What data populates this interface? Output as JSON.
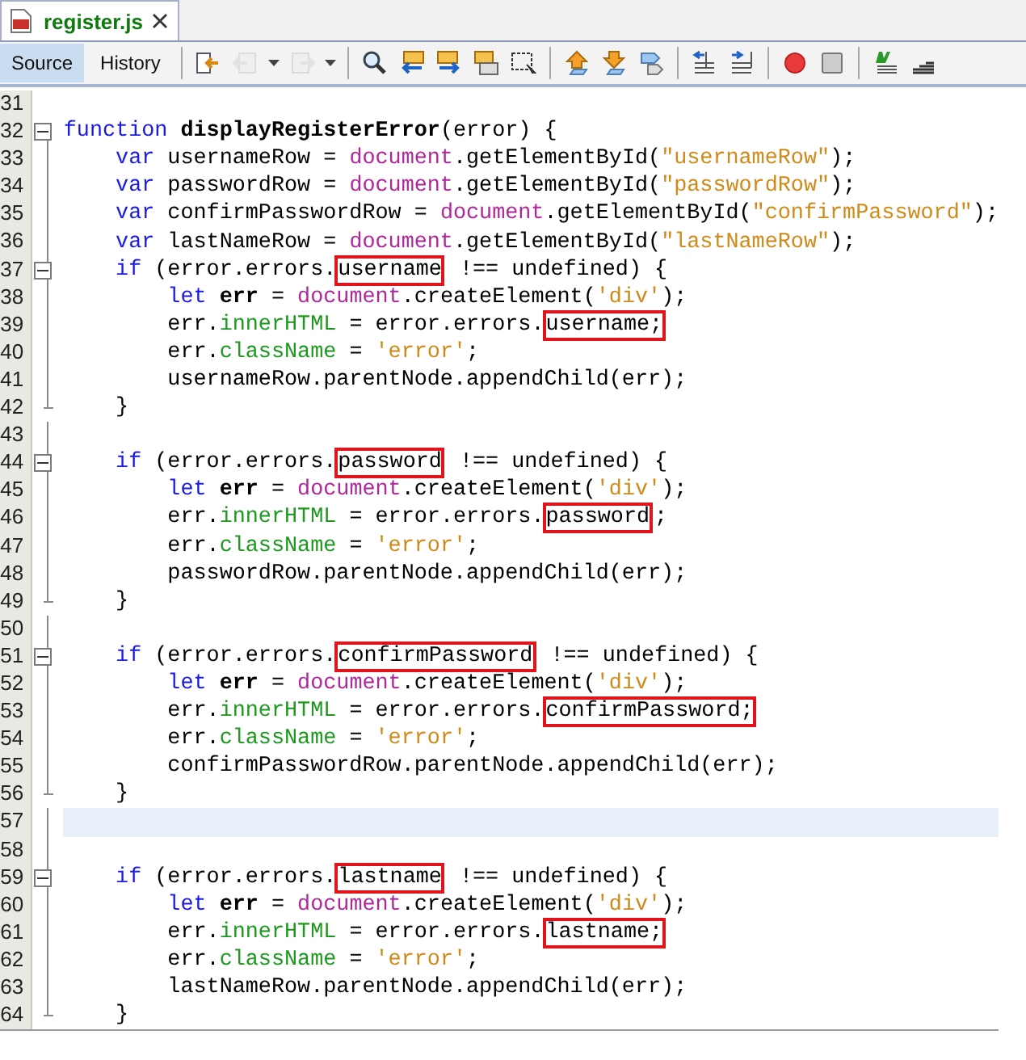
{
  "file_tab": {
    "title": "register.js",
    "selected": true
  },
  "view_tabs": [
    {
      "label": "Source",
      "selected": true
    },
    {
      "label": "History",
      "selected": false
    }
  ],
  "toolbar": [
    {
      "kind": "last-edit",
      "disabled": false
    },
    {
      "kind": "back",
      "disabled": true
    },
    {
      "kind": "dropdown"
    },
    {
      "kind": "forward",
      "disabled": true
    },
    {
      "kind": "dropdown"
    },
    {
      "kind": "separator"
    },
    {
      "kind": "find",
      "disabled": false
    },
    {
      "kind": "find-prev",
      "disabled": false
    },
    {
      "kind": "find-next",
      "disabled": false
    },
    {
      "kind": "highlight",
      "disabled": false
    },
    {
      "kind": "select",
      "disabled": false
    },
    {
      "kind": "separator"
    },
    {
      "kind": "prev-bookmark",
      "disabled": false
    },
    {
      "kind": "next-bookmark",
      "disabled": false
    },
    {
      "kind": "toggle-bookmark",
      "disabled": false
    },
    {
      "kind": "separator"
    },
    {
      "kind": "shift-left",
      "disabled": false
    },
    {
      "kind": "shift-right",
      "disabled": false
    },
    {
      "kind": "separator"
    },
    {
      "kind": "record",
      "disabled": false
    },
    {
      "kind": "stop",
      "disabled": false
    },
    {
      "kind": "separator"
    },
    {
      "kind": "comment",
      "disabled": false
    },
    {
      "kind": "uncomment",
      "disabled": false
    }
  ],
  "lines": [
    {
      "number": "31",
      "current": false,
      "fold_toggle": false,
      "fold_end": false
    },
    {
      "number": "32",
      "current": false,
      "fold_toggle": true,
      "fold_end": false,
      "tokens": [
        {
          "kind": "keyword",
          "text": "function ",
          "boxed": false
        },
        {
          "kind": "declaration",
          "text": "displayRegisterError",
          "boxed": false
        },
        {
          "kind": "plain",
          "text": "(error) {",
          "boxed": false
        }
      ]
    },
    {
      "number": "33",
      "current": false,
      "fold_toggle": false,
      "fold_end": false,
      "tokens": [
        {
          "kind": "keyword",
          "text": "    var",
          "boxed": false
        },
        {
          "kind": "plain",
          "text": " usernameRow = ",
          "boxed": false
        },
        {
          "kind": "object",
          "text": "document",
          "boxed": false
        },
        {
          "kind": "plain",
          "text": ".getElementById(",
          "boxed": false
        },
        {
          "kind": "string",
          "text": "\"usernameRow\"",
          "boxed": false
        },
        {
          "kind": "plain",
          "text": ");",
          "boxed": false
        }
      ]
    },
    {
      "number": "34",
      "current": false,
      "fold_toggle": false,
      "fold_end": false,
      "tokens": [
        {
          "kind": "keyword",
          "text": "    var",
          "boxed": false
        },
        {
          "kind": "plain",
          "text": " passwordRow = ",
          "boxed": false
        },
        {
          "kind": "object",
          "text": "document",
          "boxed": false
        },
        {
          "kind": "plain",
          "text": ".getElementById(",
          "boxed": false
        },
        {
          "kind": "string",
          "text": "\"passwordRow\"",
          "boxed": false
        },
        {
          "kind": "plain",
          "text": ");",
          "boxed": false
        }
      ]
    },
    {
      "number": "35",
      "current": false,
      "fold_toggle": false,
      "fold_end": false,
      "tokens": [
        {
          "kind": "keyword",
          "text": "    var",
          "boxed": false
        },
        {
          "kind": "plain",
          "text": " confirmPasswordRow = ",
          "boxed": false
        },
        {
          "kind": "object",
          "text": "document",
          "boxed": false
        },
        {
          "kind": "plain",
          "text": ".getElementById(",
          "boxed": false
        },
        {
          "kind": "string",
          "text": "\"confirmPassword\"",
          "boxed": false
        },
        {
          "kind": "plain",
          "text": ");",
          "boxed": false
        }
      ]
    },
    {
      "number": "36",
      "current": false,
      "fold_toggle": false,
      "fold_end": false,
      "tokens": [
        {
          "kind": "keyword",
          "text": "    var",
          "boxed": false
        },
        {
          "kind": "plain",
          "text": " lastNameRow = ",
          "boxed": false
        },
        {
          "kind": "object",
          "text": "document",
          "boxed": false
        },
        {
          "kind": "plain",
          "text": ".getElementById(",
          "boxed": false
        },
        {
          "kind": "string",
          "text": "\"lastNameRow\"",
          "boxed": false
        },
        {
          "kind": "plain",
          "text": ");",
          "boxed": false
        }
      ]
    },
    {
      "number": "37",
      "current": false,
      "fold_toggle": true,
      "fold_end": false,
      "tokens": [
        {
          "kind": "keyword",
          "text": "    if",
          "boxed": false
        },
        {
          "kind": "plain",
          "text": " (error.errors.",
          "boxed": false
        },
        {
          "kind": "plain",
          "text": "username",
          "boxed": true
        },
        {
          "kind": "plain",
          "text": " !== undefined) {",
          "boxed": false
        }
      ]
    },
    {
      "number": "38",
      "current": false,
      "fold_toggle": false,
      "fold_end": false,
      "tokens": [
        {
          "kind": "keyword",
          "text": "        let ",
          "boxed": false
        },
        {
          "kind": "declaration",
          "text": "err",
          "boxed": false
        },
        {
          "kind": "plain",
          "text": " = ",
          "boxed": false
        },
        {
          "kind": "object",
          "text": "document",
          "boxed": false
        },
        {
          "kind": "plain",
          "text": ".createElement(",
          "boxed": false
        },
        {
          "kind": "string",
          "text": "'div'",
          "boxed": false
        },
        {
          "kind": "plain",
          "text": ");",
          "boxed": false
        }
      ]
    },
    {
      "number": "39",
      "current": false,
      "fold_toggle": false,
      "fold_end": false,
      "tokens": [
        {
          "kind": "plain",
          "text": "        err.",
          "boxed": false
        },
        {
          "kind": "property",
          "text": "innerHTML",
          "boxed": false
        },
        {
          "kind": "plain",
          "text": " = error.errors.",
          "boxed": false
        },
        {
          "kind": "plain",
          "text": "username;",
          "boxed": true
        }
      ]
    },
    {
      "number": "40",
      "current": false,
      "fold_toggle": false,
      "fold_end": false,
      "tokens": [
        {
          "kind": "plain",
          "text": "        err.",
          "boxed": false
        },
        {
          "kind": "property",
          "text": "className",
          "boxed": false
        },
        {
          "kind": "plain",
          "text": " = ",
          "boxed": false
        },
        {
          "kind": "string",
          "text": "'error'",
          "boxed": false
        },
        {
          "kind": "plain",
          "text": ";",
          "boxed": false
        }
      ]
    },
    {
      "number": "41",
      "current": false,
      "fold_toggle": false,
      "fold_end": false,
      "tokens": [
        {
          "kind": "plain",
          "text": "        usernameRow.parentNode.appendChild(err);",
          "boxed": false
        }
      ]
    },
    {
      "number": "42",
      "current": false,
      "fold_toggle": false,
      "fold_end": true,
      "tokens": [
        {
          "kind": "plain",
          "text": "    }",
          "boxed": false
        }
      ]
    },
    {
      "number": "43",
      "current": false,
      "fold_toggle": false,
      "fold_end": false
    },
    {
      "number": "44",
      "current": false,
      "fold_toggle": true,
      "fold_end": false,
      "tokens": [
        {
          "kind": "keyword",
          "text": "    if",
          "boxed": false
        },
        {
          "kind": "plain",
          "text": " (error.errors.",
          "boxed": false
        },
        {
          "kind": "plain",
          "text": "password",
          "boxed": true
        },
        {
          "kind": "plain",
          "text": " !== undefined) {",
          "boxed": false
        }
      ]
    },
    {
      "number": "45",
      "current": false,
      "fold_toggle": false,
      "fold_end": false,
      "tokens": [
        {
          "kind": "keyword",
          "text": "        let ",
          "boxed": false
        },
        {
          "kind": "declaration",
          "text": "err",
          "boxed": false
        },
        {
          "kind": "plain",
          "text": " = ",
          "boxed": false
        },
        {
          "kind": "object",
          "text": "document",
          "boxed": false
        },
        {
          "kind": "plain",
          "text": ".createElement(",
          "boxed": false
        },
        {
          "kind": "string",
          "text": "'div'",
          "boxed": false
        },
        {
          "kind": "plain",
          "text": ");",
          "boxed": false
        }
      ]
    },
    {
      "number": "46",
      "current": false,
      "fold_toggle": false,
      "fold_end": false,
      "tokens": [
        {
          "kind": "plain",
          "text": "        err.",
          "boxed": false
        },
        {
          "kind": "property",
          "text": "innerHTML",
          "boxed": false
        },
        {
          "kind": "plain",
          "text": " = error.errors.",
          "boxed": false
        },
        {
          "kind": "plain",
          "text": "password",
          "boxed": true
        },
        {
          "kind": "plain",
          "text": ";",
          "boxed": false
        }
      ]
    },
    {
      "number": "47",
      "current": false,
      "fold_toggle": false,
      "fold_end": false,
      "tokens": [
        {
          "kind": "plain",
          "text": "        err.",
          "boxed": false
        },
        {
          "kind": "property",
          "text": "className",
          "boxed": false
        },
        {
          "kind": "plain",
          "text": " = ",
          "boxed": false
        },
        {
          "kind": "string",
          "text": "'error'",
          "boxed": false
        },
        {
          "kind": "plain",
          "text": ";",
          "boxed": false
        }
      ]
    },
    {
      "number": "48",
      "current": false,
      "fold_toggle": false,
      "fold_end": false,
      "tokens": [
        {
          "kind": "plain",
          "text": "        passwordRow.parentNode.appendChild(err);",
          "boxed": false
        }
      ]
    },
    {
      "number": "49",
      "current": false,
      "fold_toggle": false,
      "fold_end": true,
      "tokens": [
        {
          "kind": "plain",
          "text": "    }",
          "boxed": false
        }
      ]
    },
    {
      "number": "50",
      "current": false,
      "fold_toggle": false,
      "fold_end": false
    },
    {
      "number": "51",
      "current": false,
      "fold_toggle": true,
      "fold_end": false,
      "tokens": [
        {
          "kind": "keyword",
          "text": "    if",
          "boxed": false
        },
        {
          "kind": "plain",
          "text": " (error.errors.",
          "boxed": false
        },
        {
          "kind": "plain",
          "text": "confirmPassword",
          "boxed": true
        },
        {
          "kind": "plain",
          "text": " !== undefined) {",
          "boxed": false
        }
      ]
    },
    {
      "number": "52",
      "current": false,
      "fold_toggle": false,
      "fold_end": false,
      "tokens": [
        {
          "kind": "keyword",
          "text": "        let ",
          "boxed": false
        },
        {
          "kind": "declaration",
          "text": "err",
          "boxed": false
        },
        {
          "kind": "plain",
          "text": " = ",
          "boxed": false
        },
        {
          "kind": "object",
          "text": "document",
          "boxed": false
        },
        {
          "kind": "plain",
          "text": ".createElement(",
          "boxed": false
        },
        {
          "kind": "string",
          "text": "'div'",
          "boxed": false
        },
        {
          "kind": "plain",
          "text": ");",
          "boxed": false
        }
      ]
    },
    {
      "number": "53",
      "current": false,
      "fold_toggle": false,
      "fold_end": false,
      "tokens": [
        {
          "kind": "plain",
          "text": "        err.",
          "boxed": false
        },
        {
          "kind": "property",
          "text": "innerHTML",
          "boxed": false
        },
        {
          "kind": "plain",
          "text": " = error.errors.",
          "boxed": false
        },
        {
          "kind": "plain",
          "text": "confirmPassword;",
          "boxed": true
        }
      ]
    },
    {
      "number": "54",
      "current": false,
      "fold_toggle": false,
      "fold_end": false,
      "tokens": [
        {
          "kind": "plain",
          "text": "        err.",
          "boxed": false
        },
        {
          "kind": "property",
          "text": "className",
          "boxed": false
        },
        {
          "kind": "plain",
          "text": " = ",
          "boxed": false
        },
        {
          "kind": "string",
          "text": "'error'",
          "boxed": false
        },
        {
          "kind": "plain",
          "text": ";",
          "boxed": false
        }
      ]
    },
    {
      "number": "55",
      "current": false,
      "fold_toggle": false,
      "fold_end": false,
      "tokens": [
        {
          "kind": "plain",
          "text": "        confirmPasswordRow.parentNode.appendChild(err);",
          "boxed": false
        }
      ]
    },
    {
      "number": "56",
      "current": false,
      "fold_toggle": false,
      "fold_end": true,
      "tokens": [
        {
          "kind": "plain",
          "text": "    }",
          "boxed": false
        }
      ]
    },
    {
      "number": "57",
      "current": true,
      "fold_toggle": false,
      "fold_end": false
    },
    {
      "number": "58",
      "current": false,
      "fold_toggle": false,
      "fold_end": false
    },
    {
      "number": "59",
      "current": false,
      "fold_toggle": true,
      "fold_end": false,
      "tokens": [
        {
          "kind": "keyword",
          "text": "    if",
          "boxed": false
        },
        {
          "kind": "plain",
          "text": " (error.errors.",
          "boxed": false
        },
        {
          "kind": "plain",
          "text": "lastname",
          "boxed": true
        },
        {
          "kind": "plain",
          "text": " !== undefined) {",
          "boxed": false
        }
      ]
    },
    {
      "number": "60",
      "current": false,
      "fold_toggle": false,
      "fold_end": false,
      "tokens": [
        {
          "kind": "keyword",
          "text": "        let ",
          "boxed": false
        },
        {
          "kind": "declaration",
          "text": "err",
          "boxed": false
        },
        {
          "kind": "plain",
          "text": " = ",
          "boxed": false
        },
        {
          "kind": "object",
          "text": "document",
          "boxed": false
        },
        {
          "kind": "plain",
          "text": ".createElement(",
          "boxed": false
        },
        {
          "kind": "string",
          "text": "'div'",
          "boxed": false
        },
        {
          "kind": "plain",
          "text": ");",
          "boxed": false
        }
      ]
    },
    {
      "number": "61",
      "current": false,
      "fold_toggle": false,
      "fold_end": false,
      "tokens": [
        {
          "kind": "plain",
          "text": "        err.",
          "boxed": false
        },
        {
          "kind": "property",
          "text": "innerHTML",
          "boxed": false
        },
        {
          "kind": "plain",
          "text": " = error.errors.",
          "boxed": false
        },
        {
          "kind": "plain",
          "text": "lastname;",
          "boxed": true
        }
      ]
    },
    {
      "number": "62",
      "current": false,
      "fold_toggle": false,
      "fold_end": false,
      "tokens": [
        {
          "kind": "plain",
          "text": "        err.",
          "boxed": false
        },
        {
          "kind": "property",
          "text": "className",
          "boxed": false
        },
        {
          "kind": "plain",
          "text": " = ",
          "boxed": false
        },
        {
          "kind": "string",
          "text": "'error'",
          "boxed": false
        },
        {
          "kind": "plain",
          "text": ";",
          "boxed": false
        }
      ]
    },
    {
      "number": "63",
      "current": false,
      "fold_toggle": false,
      "fold_end": false,
      "tokens": [
        {
          "kind": "plain",
          "text": "        lastNameRow.parentNode.appendChild(err);",
          "boxed": false
        }
      ]
    },
    {
      "number": "64",
      "current": false,
      "fold_toggle": false,
      "fold_end": true,
      "tokens": [
        {
          "kind": "plain",
          "text": "    }",
          "boxed": false
        }
      ]
    }
  ]
}
